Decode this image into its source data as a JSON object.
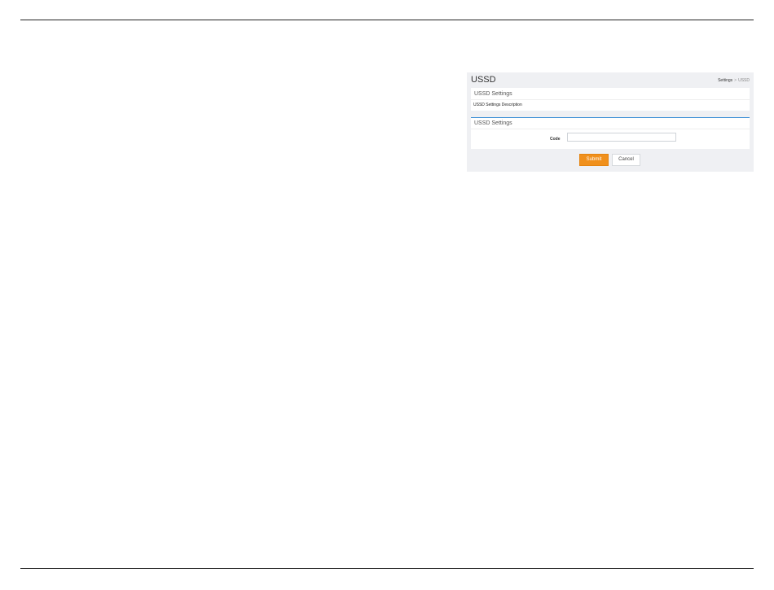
{
  "page": {
    "title": "USSD"
  },
  "breadcrumb": {
    "parent": "Settings",
    "separator": ">",
    "current": "USSD"
  },
  "description_panel": {
    "heading": "USSD Settings",
    "text": "USSD Settings Description"
  },
  "form_panel": {
    "heading": "USSD Settings",
    "code_label": "Code",
    "code_value": "",
    "code_placeholder": ""
  },
  "actions": {
    "submit_label": "Submit",
    "cancel_label": "Cancel"
  },
  "colors": {
    "accent": "#f0901c",
    "panel_border": "#3b8fd6",
    "background": "#eff0f3"
  }
}
